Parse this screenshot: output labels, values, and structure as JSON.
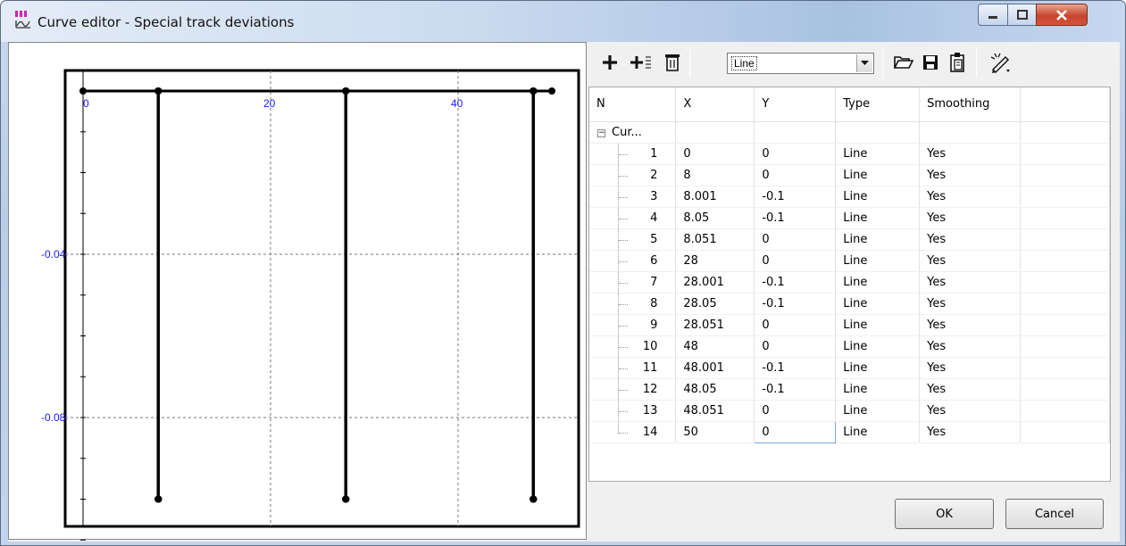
{
  "window": {
    "title": "Curve editor - Special track deviations",
    "colors": {
      "title_gradient_start": "#e4ecf7",
      "close_button": "#c7452d"
    }
  },
  "toolbar": {
    "icons": [
      "plus-icon",
      "insert-row-icon",
      "trash-icon",
      "folder-open-icon",
      "save-icon",
      "paste-icon",
      "edit-magic-icon"
    ],
    "type_select_value": "Line"
  },
  "plot": {
    "x_ticks": [
      "0",
      "20",
      "40"
    ],
    "y_ticks": [
      "-0.04",
      "-0.08"
    ]
  },
  "table": {
    "columns": [
      "N",
      "X",
      "Y",
      "Type",
      "Smoothing"
    ],
    "group_label": "Cur...",
    "rows": [
      {
        "n": "1",
        "x": "0",
        "y": "0",
        "type": "Line",
        "smoothing": "Yes"
      },
      {
        "n": "2",
        "x": "8",
        "y": "0",
        "type": "Line",
        "smoothing": "Yes"
      },
      {
        "n": "3",
        "x": "8.001",
        "y": "-0.1",
        "type": "Line",
        "smoothing": "Yes"
      },
      {
        "n": "4",
        "x": "8.05",
        "y": "-0.1",
        "type": "Line",
        "smoothing": "Yes"
      },
      {
        "n": "5",
        "x": "8.051",
        "y": "0",
        "type": "Line",
        "smoothing": "Yes"
      },
      {
        "n": "6",
        "x": "28",
        "y": "0",
        "type": "Line",
        "smoothing": "Yes"
      },
      {
        "n": "7",
        "x": "28.001",
        "y": "-0.1",
        "type": "Line",
        "smoothing": "Yes"
      },
      {
        "n": "8",
        "x": "28.05",
        "y": "-0.1",
        "type": "Line",
        "smoothing": "Yes"
      },
      {
        "n": "9",
        "x": "28.051",
        "y": "0",
        "type": "Line",
        "smoothing": "Yes"
      },
      {
        "n": "10",
        "x": "48",
        "y": "0",
        "type": "Line",
        "smoothing": "Yes"
      },
      {
        "n": "11",
        "x": "48.001",
        "y": "-0.1",
        "type": "Line",
        "smoothing": "Yes"
      },
      {
        "n": "12",
        "x": "48.05",
        "y": "-0.1",
        "type": "Line",
        "smoothing": "Yes"
      },
      {
        "n": "13",
        "x": "48.051",
        "y": "0",
        "type": "Line",
        "smoothing": "Yes"
      },
      {
        "n": "14",
        "x": "50",
        "y": "0",
        "type": "Line",
        "smoothing": "Yes"
      }
    ]
  },
  "buttons": {
    "ok": "OK",
    "cancel": "Cancel"
  }
}
